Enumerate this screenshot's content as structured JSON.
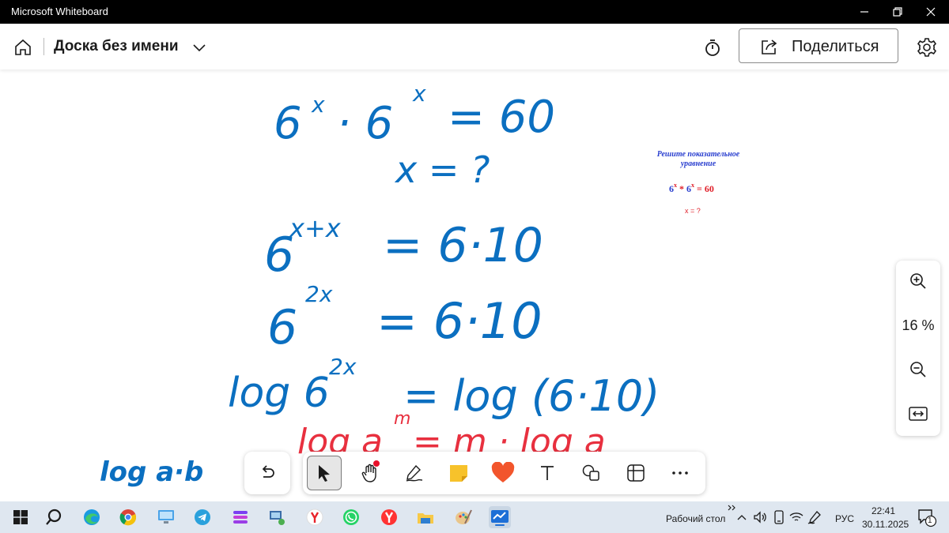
{
  "window": {
    "title": "Microsoft Whiteboard",
    "controls": [
      "minimize-icon",
      "restore-icon",
      "close-icon"
    ]
  },
  "header": {
    "board_title": "Доска без имени",
    "share_label": "Поделиться",
    "icons": [
      "home-icon",
      "chevron-down-icon",
      "timer-icon",
      "share-icon",
      "gear-icon"
    ]
  },
  "canvas": {
    "ink_color": "#0b6fc0",
    "ink_red_color": "#e8303f",
    "lines": {
      "eq1_left": "6",
      "eq1_exp1": "x",
      "eq1_mid": "· 6",
      "eq1_exp2": "x",
      "eq1_right": "= 60",
      "eq2": "x = ?",
      "eq3_base": "6",
      "eq3_exp": "x+x",
      "eq3_right": "= 6·10",
      "eq4_base": "6",
      "eq4_exp": "2x",
      "eq4_right": "= 6·10",
      "eq5_left": "log 6",
      "eq5_exp": "2x",
      "eq5_right": "= log (6·10)",
      "eq6_red": "log a",
      "eq6_red_exp": "m",
      "eq6_red_right": "= m · log a",
      "side_note": "log a·b"
    },
    "reference_card": {
      "title_line1": "Решите показательное",
      "title_line2": "уравнение",
      "eq_b1": "6",
      "eq_s1": "x",
      "eq_op": "*",
      "eq_b2": "6",
      "eq_s2": "x",
      "eq_rhs": "= 60",
      "question": "x = ?"
    }
  },
  "zoom": {
    "level": "16 %",
    "icons": [
      "zoom-in-icon",
      "zoom-out-icon",
      "fit-width-icon"
    ]
  },
  "toolbar": {
    "tools": [
      "undo-icon",
      "select-pointer-icon",
      "hand-pan-icon",
      "pen-icon",
      "sticky-note-icon",
      "reactions-heart-icon",
      "text-tool-icon",
      "shapes-icon",
      "templates-icon",
      "more-icon"
    ],
    "colors": {
      "sticky": "#f7c22b",
      "heart": "#f2552c",
      "dot": "#e8102a"
    }
  },
  "taskbar": {
    "desktop_label": "Рабочий стол",
    "lang": "РУС",
    "time": "22:41",
    "date": "30.11.2025",
    "notif_count": "1",
    "icons": [
      "windows-start-icon",
      "search-icon",
      "edge-icon",
      "chrome-icon",
      "remote-desktop-icon",
      "telegram-icon",
      "stacks-icon",
      "network-pc-icon",
      "yandex-browser-icon",
      "whatsapp-icon",
      "yandex-icon",
      "file-explorer-icon",
      "paint-icon",
      "whiteboard-icon"
    ]
  }
}
